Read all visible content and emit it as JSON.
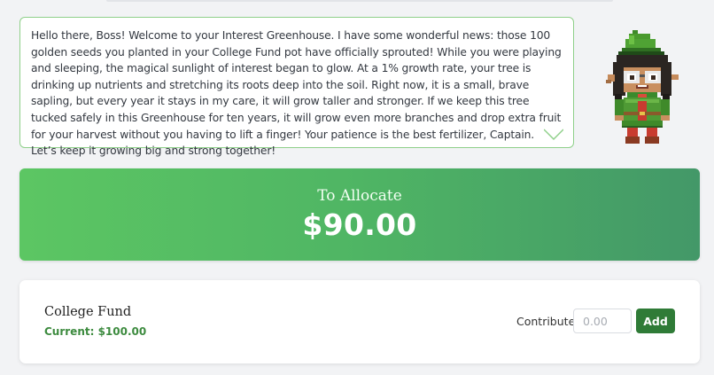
{
  "speech": {
    "text": "Hello there, Boss! Welcome to your Interest Greenhouse. I have some wonderful news: those 100 golden seeds you planted in your College Fund pot have officially sprouted! While you were playing and sleeping, the magical sunlight of interest began to glow. At a 1% growth rate, your tree is drinking up nutrients and stretching its roots deep into the soil. Right now, it is a small, brave sapling, but every year it stays in my care, it will grow taller and stronger. If we keep this tree tucked safely in this Greenhouse for ten years, it will grow even more branches and drop extra fruit for your harvest without you having to lift a finger! Your patience is the best fertilizer, Captain. Let’s keep it growing big and strong together!"
  },
  "character": {
    "icon": "elf-gardener-character-icon"
  },
  "allocate": {
    "label": "To Allocate",
    "amount": "$90.00"
  },
  "fund": {
    "name": "College Fund",
    "current": "Current: $100.00",
    "contribute_label": "Contribute:",
    "input_placeholder": "0.00",
    "input_value": "",
    "add_label": "Add"
  },
  "colors": {
    "accent_green": "#2f7b37",
    "gradient_start": "#5cc663",
    "gradient_end": "#439868",
    "speech_border": "#8fd08a"
  }
}
